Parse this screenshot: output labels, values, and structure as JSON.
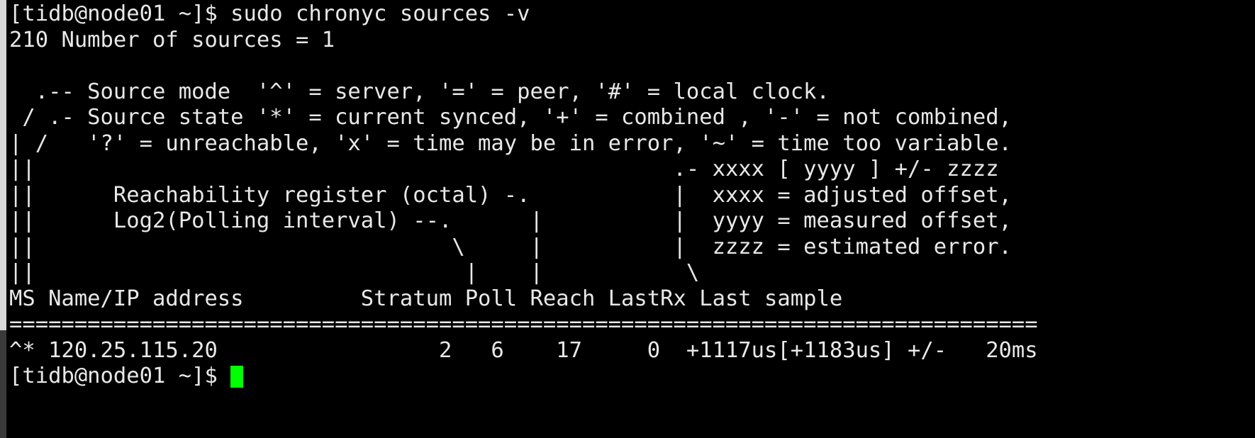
{
  "window": {
    "title": "chronyc sources -v",
    "background_color": "#000000",
    "foreground_color": "#e8e8e8",
    "cursor_color": "#00ff00",
    "scrollbar_track_color": "#3a3a3a",
    "scrollbar_thumb_color": "#d8d8d8"
  },
  "terminal": {
    "prompt": "[tidb@node01 ~]$",
    "command": "sudo chronyc sources -v",
    "lines": [
      "[tidb@node01 ~]$ sudo chronyc sources -v",
      "210 Number of sources = 1",
      "",
      "  .-- Source mode  '^' = server, '=' = peer, '#' = local clock.",
      " / .- Source state '*' = current synced, '+' = combined , '-' = not combined,",
      "| /   '?' = unreachable, 'x' = time may be in error, '~' = time too variable.",
      "||                                                 .- xxxx [ yyyy ] +/- zzzz",
      "||      Reachability register (octal) -.           |  xxxx = adjusted offset,",
      "||      Log2(Polling interval) --.      |          |  yyyy = measured offset,",
      "||                                \\     |          |  zzzz = estimated error.",
      "||                                 |    |           \\",
      "MS Name/IP address         Stratum Poll Reach LastRx Last sample",
      "===============================================================================",
      "^* 120.25.115.20                 2   6    17     0  +1117us[+1183us] +/-   20ms",
      "[tidb@node01 ~]$ "
    ],
    "status_line": "210 Number of sources = 1",
    "number_of_sources": "1",
    "status_code": "210"
  },
  "legend": {
    "source_mode_line": "  .-- Source mode  '^' = server, '=' = peer, '#' = local clock.",
    "source_state_line": " / .- Source state '*' = current synced, '+' = combined , '-' = not combined,",
    "unreachable_line": "| /   '?' = unreachable, 'x' = time may be in error, '~' = time too variable.",
    "sample_format_line": "||                                                 .- xxxx [ yyyy ] +/- zzzz",
    "reachability_line": "||      Reachability register (octal) -.           |  xxxx = adjusted offset,",
    "polling_line": "||      Log2(Polling interval) --.      |          |  yyyy = measured offset,",
    "error_line": "||                                \\     |          |  zzzz = estimated error.",
    "pointer_line": "||                                 |    |           \\",
    "symbols": {
      "server": "^",
      "peer": "=",
      "local_clock": "#",
      "current_synced": "*",
      "combined": "+",
      "not_combined": "-",
      "unreachable": "?",
      "time_may_be_in_error": "x",
      "time_too_variable": "~"
    },
    "sample_fields": {
      "xxxx": "adjusted offset",
      "yyyy": "measured offset",
      "zzzz": "estimated error"
    }
  },
  "table": {
    "header_line": "MS Name/IP address         Stratum Poll Reach LastRx Last sample",
    "separator_line": "===============================================================================",
    "columns": [
      "MS",
      "Name/IP address",
      "Stratum",
      "Poll",
      "Reach",
      "LastRx",
      "Last sample"
    ],
    "rows": [
      {
        "raw": "^* 120.25.115.20                 2   6    17     0  +1117us[+1183us] +/-   20ms",
        "ms": "^*",
        "name_ip_address": "120.25.115.20",
        "stratum": "2",
        "poll": "6",
        "reach": "17",
        "lastrx": "0",
        "last_sample": "+1117us[+1183us] +/-   20ms",
        "adjusted_offset": "+1117us",
        "measured_offset": "+1183us",
        "estimated_error": "20ms"
      }
    ]
  },
  "final_prompt": {
    "text": "[tidb@node01 ~]$ ",
    "cursor": "block"
  }
}
